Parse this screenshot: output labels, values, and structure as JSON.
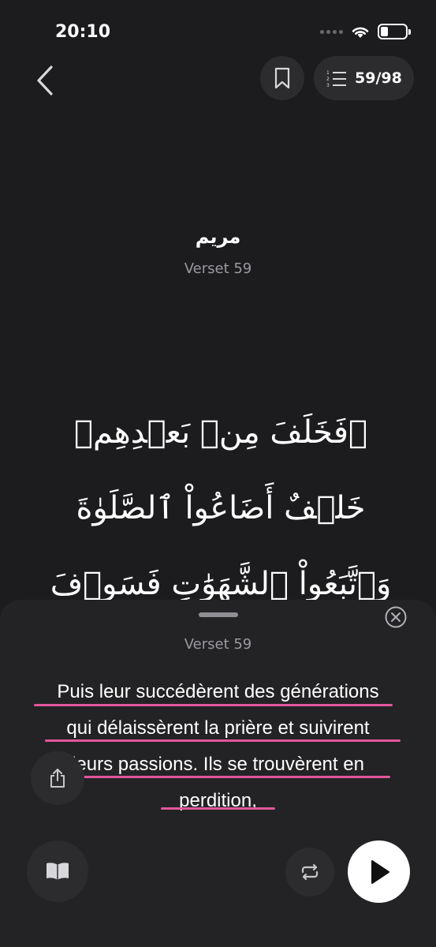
{
  "status_bar": {
    "time": "20:10",
    "icons": [
      "signal-dots-icon",
      "wifi-icon",
      "battery-icon"
    ],
    "battery_level": 0.3
  },
  "nav": {
    "back_icon": "chevron-left-icon",
    "bookmark_icon": "bookmark-icon",
    "progress_icon": "numbered-list-icon",
    "progress_label": "59/98",
    "current_verse": 59,
    "total_verses": 98
  },
  "surah": {
    "name": "مريم",
    "verse_label": "Verset 59"
  },
  "arabic_verse": {
    "lines": [
      "۞فَخَلَفَ مِنۢ بَعۡدِهِمۡ",
      "خَلۡفٌ أَضَاعُواْ ٱلصَّلَوٰةَ",
      "وَٱتَّبَعُواْ ٱلشَّهَوَٰتِ فَسَوۡفَ"
    ]
  },
  "sheet": {
    "verse_label": "Verset 59",
    "close_icon": "close-circle-icon",
    "translation_lines": [
      "Puis leur succédèrent des générations",
      "qui délaissèrent la prière et suivirent",
      "leurs passions. Ils se trouvèrent en",
      "perdition,"
    ],
    "highlight_color": "#e2569c"
  },
  "controls": {
    "share_icon": "share-icon",
    "book_icon": "book-open-icon",
    "repeat_icon": "repeat-icon",
    "play_icon": "play-icon"
  },
  "colors": {
    "background": "#1c1c1e",
    "sheet": "#232325",
    "button": "#2c2c2e",
    "secondary_text": "#9a9aa0"
  }
}
